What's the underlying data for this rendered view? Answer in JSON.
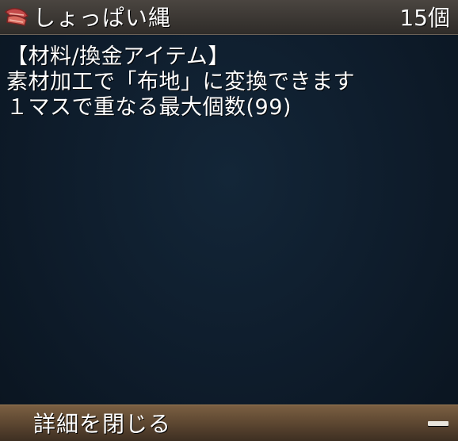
{
  "item": {
    "name": "しょっぱい縄",
    "count": "15個",
    "icon": "rope-icon"
  },
  "description": {
    "lines": [
      "【材料/換金アイテム】",
      "素材加工で「布地」に変換できます",
      "１マスで重なる最大個数(99)"
    ]
  },
  "footer": {
    "close_label": "詳細を閉じる",
    "collapse_icon": "minus-icon"
  },
  "colors": {
    "panel_bg": "#0e1c2b",
    "header_bg": "#3b3733",
    "footer_bg": "#5d4731",
    "text": "#ffffff",
    "icon_red": "#c44a4a"
  }
}
